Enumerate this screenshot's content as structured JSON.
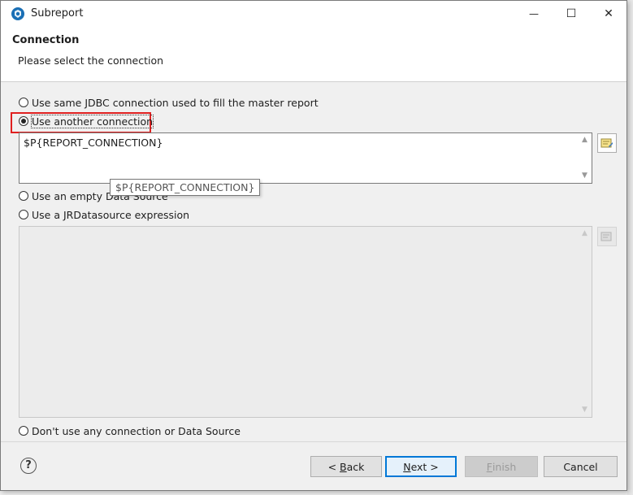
{
  "window": {
    "title": "Subreport"
  },
  "window_controls": {
    "minimize": "—",
    "maximize": "☐",
    "close": "✕"
  },
  "header": {
    "title": "Connection",
    "description": "Please select the connection"
  },
  "options": {
    "same_jdbc": "Use same JDBC connection used to fill the master report",
    "another_connection": "Use another connection",
    "empty_datasource": "Use an empty Data Source",
    "jrdatasource": "Use a JRDatasource expression",
    "no_connection": "Don't use any connection or Data Source"
  },
  "selected_option": "another_connection",
  "connection_expression": "$P{REPORT_CONNECTION}",
  "tooltip": "$P{REPORT_CONNECTION}",
  "datasource_expression": "",
  "buttons": {
    "back_prefix": "< ",
    "back_mnemonic": "B",
    "back_rest": "ack",
    "next_mnemonic": "N",
    "next_rest": "ext >",
    "finish_mnemonic": "F",
    "finish_rest": "inish",
    "cancel": "Cancel"
  },
  "help": {
    "glyph": "?"
  },
  "icons": {
    "app": "jaspersoft-icon",
    "expression_editor": "expression-editor-icon"
  },
  "colors": {
    "highlight": "#e02020",
    "default_button": "#0078d7"
  }
}
